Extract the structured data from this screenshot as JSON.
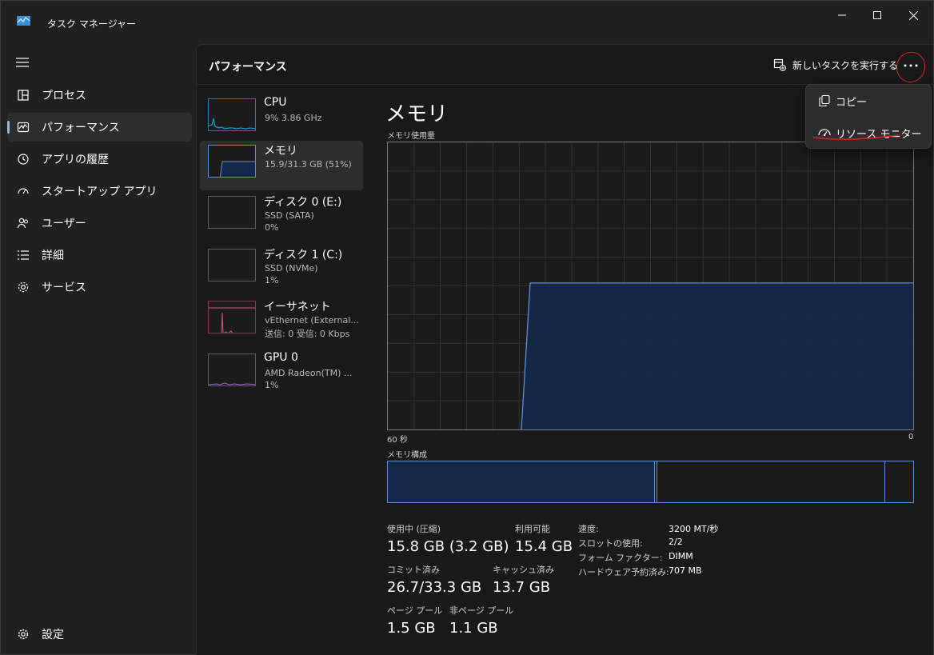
{
  "window": {
    "title": "タスク マネージャー",
    "controls": {
      "minimize": "minimize-icon",
      "maximize": "maximize-icon",
      "close": "close-icon"
    }
  },
  "sidebar": {
    "items": [
      {
        "label": "プロセス",
        "icon": "processes-icon"
      },
      {
        "label": "パフォーマンス",
        "icon": "performance-icon",
        "active": true
      },
      {
        "label": "アプリの履歴",
        "icon": "history-icon"
      },
      {
        "label": "スタートアップ アプリ",
        "icon": "startup-icon"
      },
      {
        "label": "ユーザー",
        "icon": "users-icon"
      },
      {
        "label": "詳細",
        "icon": "details-icon"
      },
      {
        "label": "サービス",
        "icon": "services-icon"
      }
    ],
    "settings_label": "設定"
  },
  "header": {
    "title": "パフォーマンス",
    "run_task_label": "新しいタスクを実行する"
  },
  "devices": [
    {
      "name": "CPU",
      "line1": "9%  3.86 GHz",
      "line2": "",
      "color": "#2aa6c9"
    },
    {
      "name": "メモリ",
      "line1": "15.9/31.3 GB (51%)",
      "line2": "",
      "color": "#5b8fd6",
      "active": true
    },
    {
      "name": "ディスク 0 (E:)",
      "line1": "SSD (SATA)",
      "line2": "0%",
      "color": "#6fb44a"
    },
    {
      "name": "ディスク 1 (C:)",
      "line1": "SSD (NVMe)",
      "line2": "1%",
      "color": "#6fb44a"
    },
    {
      "name": "イーサネット",
      "line1": "vEthernet (External...",
      "line2": "送信: 0 受信: 0 Kbps",
      "color": "#c45a8a"
    },
    {
      "name": "GPU 0",
      "line1": "AMD Radeon(TM) ...",
      "line2": "1%",
      "color": "#9a6ad0"
    }
  ],
  "memory": {
    "title": "メモリ",
    "usage_label": "メモリ使用量",
    "axis_left": "60 秒",
    "axis_right": "0",
    "composition_label": "メモリ構成",
    "usage_level_fraction": 0.51,
    "composition_in_use_fraction": 0.51,
    "stats": {
      "in_use_label": "使用中 (圧縮)",
      "in_use_value": "15.8 GB (3.2 GB)",
      "available_label": "利用可能",
      "available_value": "15.4 GB",
      "committed_label": "コミット済み",
      "committed_value": "26.7/33.3 GB",
      "cached_label": "キャッシュ済み",
      "cached_value": "13.7 GB",
      "paged_label": "ページ プール",
      "paged_value": "1.5 GB",
      "nonpaged_label": "非ページ プール",
      "nonpaged_value": "1.1 GB"
    },
    "specs": [
      {
        "key": "速度:",
        "value": "3200 MT/秒"
      },
      {
        "key": "スロットの使用:",
        "value": "2/2"
      },
      {
        "key": "フォーム ファクター:",
        "value": "DIMM"
      },
      {
        "key": "ハードウェア予約済み:",
        "value": "707 MB"
      }
    ]
  },
  "context_menu": {
    "items": [
      {
        "label": "コピー",
        "icon": "copy-icon"
      },
      {
        "label": "リソース モニター",
        "icon": "resource-monitor-icon"
      }
    ]
  },
  "colors": {
    "accent": "#8fb8e8",
    "memory_line": "#5b8fd6",
    "memory_fill": "#142848",
    "annotation": "#e0202a"
  }
}
